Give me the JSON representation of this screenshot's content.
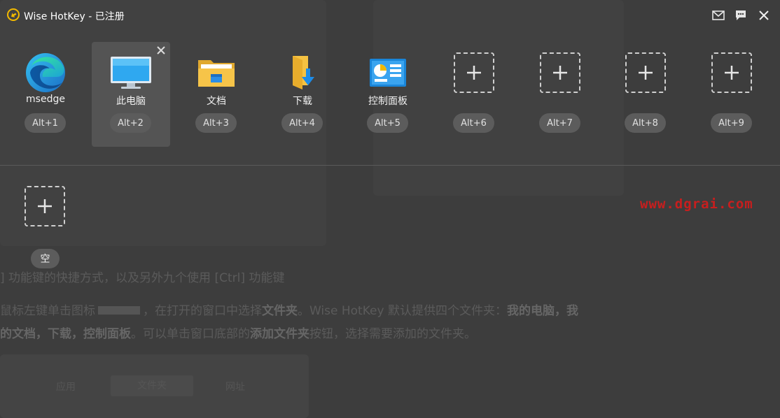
{
  "app": {
    "title": "Wise HotKey - 已注册"
  },
  "titlebar": {
    "buttons": [
      {
        "name": "mail-icon"
      },
      {
        "name": "chat-icon"
      },
      {
        "name": "close-icon"
      }
    ]
  },
  "slots": [
    {
      "label": "msedge",
      "hotkey": "Alt+1",
      "icon": "edge-icon"
    },
    {
      "label": "此电脑",
      "hotkey": "Alt+2",
      "icon": "computer-icon",
      "selected": true
    },
    {
      "label": "文档",
      "hotkey": "Alt+3",
      "icon": "folder-icon"
    },
    {
      "label": "下载",
      "hotkey": "Alt+4",
      "icon": "download-folder-icon"
    },
    {
      "label": "控制面板",
      "hotkey": "Alt+5",
      "icon": "control-panel-icon"
    },
    {
      "label": "",
      "hotkey": "Alt+6",
      "icon": "add-icon"
    },
    {
      "label": "",
      "hotkey": "Alt+7",
      "icon": "add-icon"
    },
    {
      "label": "",
      "hotkey": "Alt+8",
      "icon": "add-icon"
    },
    {
      "label": "",
      "hotkey": "Alt+9",
      "icon": "add-icon"
    }
  ],
  "second_row": {
    "slot_badge": "空",
    "icon": "add-icon"
  },
  "watermark": "www.dgrai.com",
  "background_doc": {
    "line1": "] 功能键的快捷方式，以及另外九个使用 [Ctrl] 功能键",
    "line2_a": "鼠标左键单击图标",
    "line2_b": "，在打开的窗口中选择",
    "line2_c": "文件夹",
    "line2_d": "。Wise HotKey 默认提供四个文件夹：",
    "line2_e": "我的电脑，我",
    "line3_a": "的文档，下载，控制面板",
    "line3_b": "。可以单击窗口底部的",
    "line3_c": "添加文件夹",
    "line3_d": "按钮，选择需要添加的文件夹。",
    "dialog_tabs": [
      "应用",
      "文件夹",
      "网址"
    ]
  }
}
